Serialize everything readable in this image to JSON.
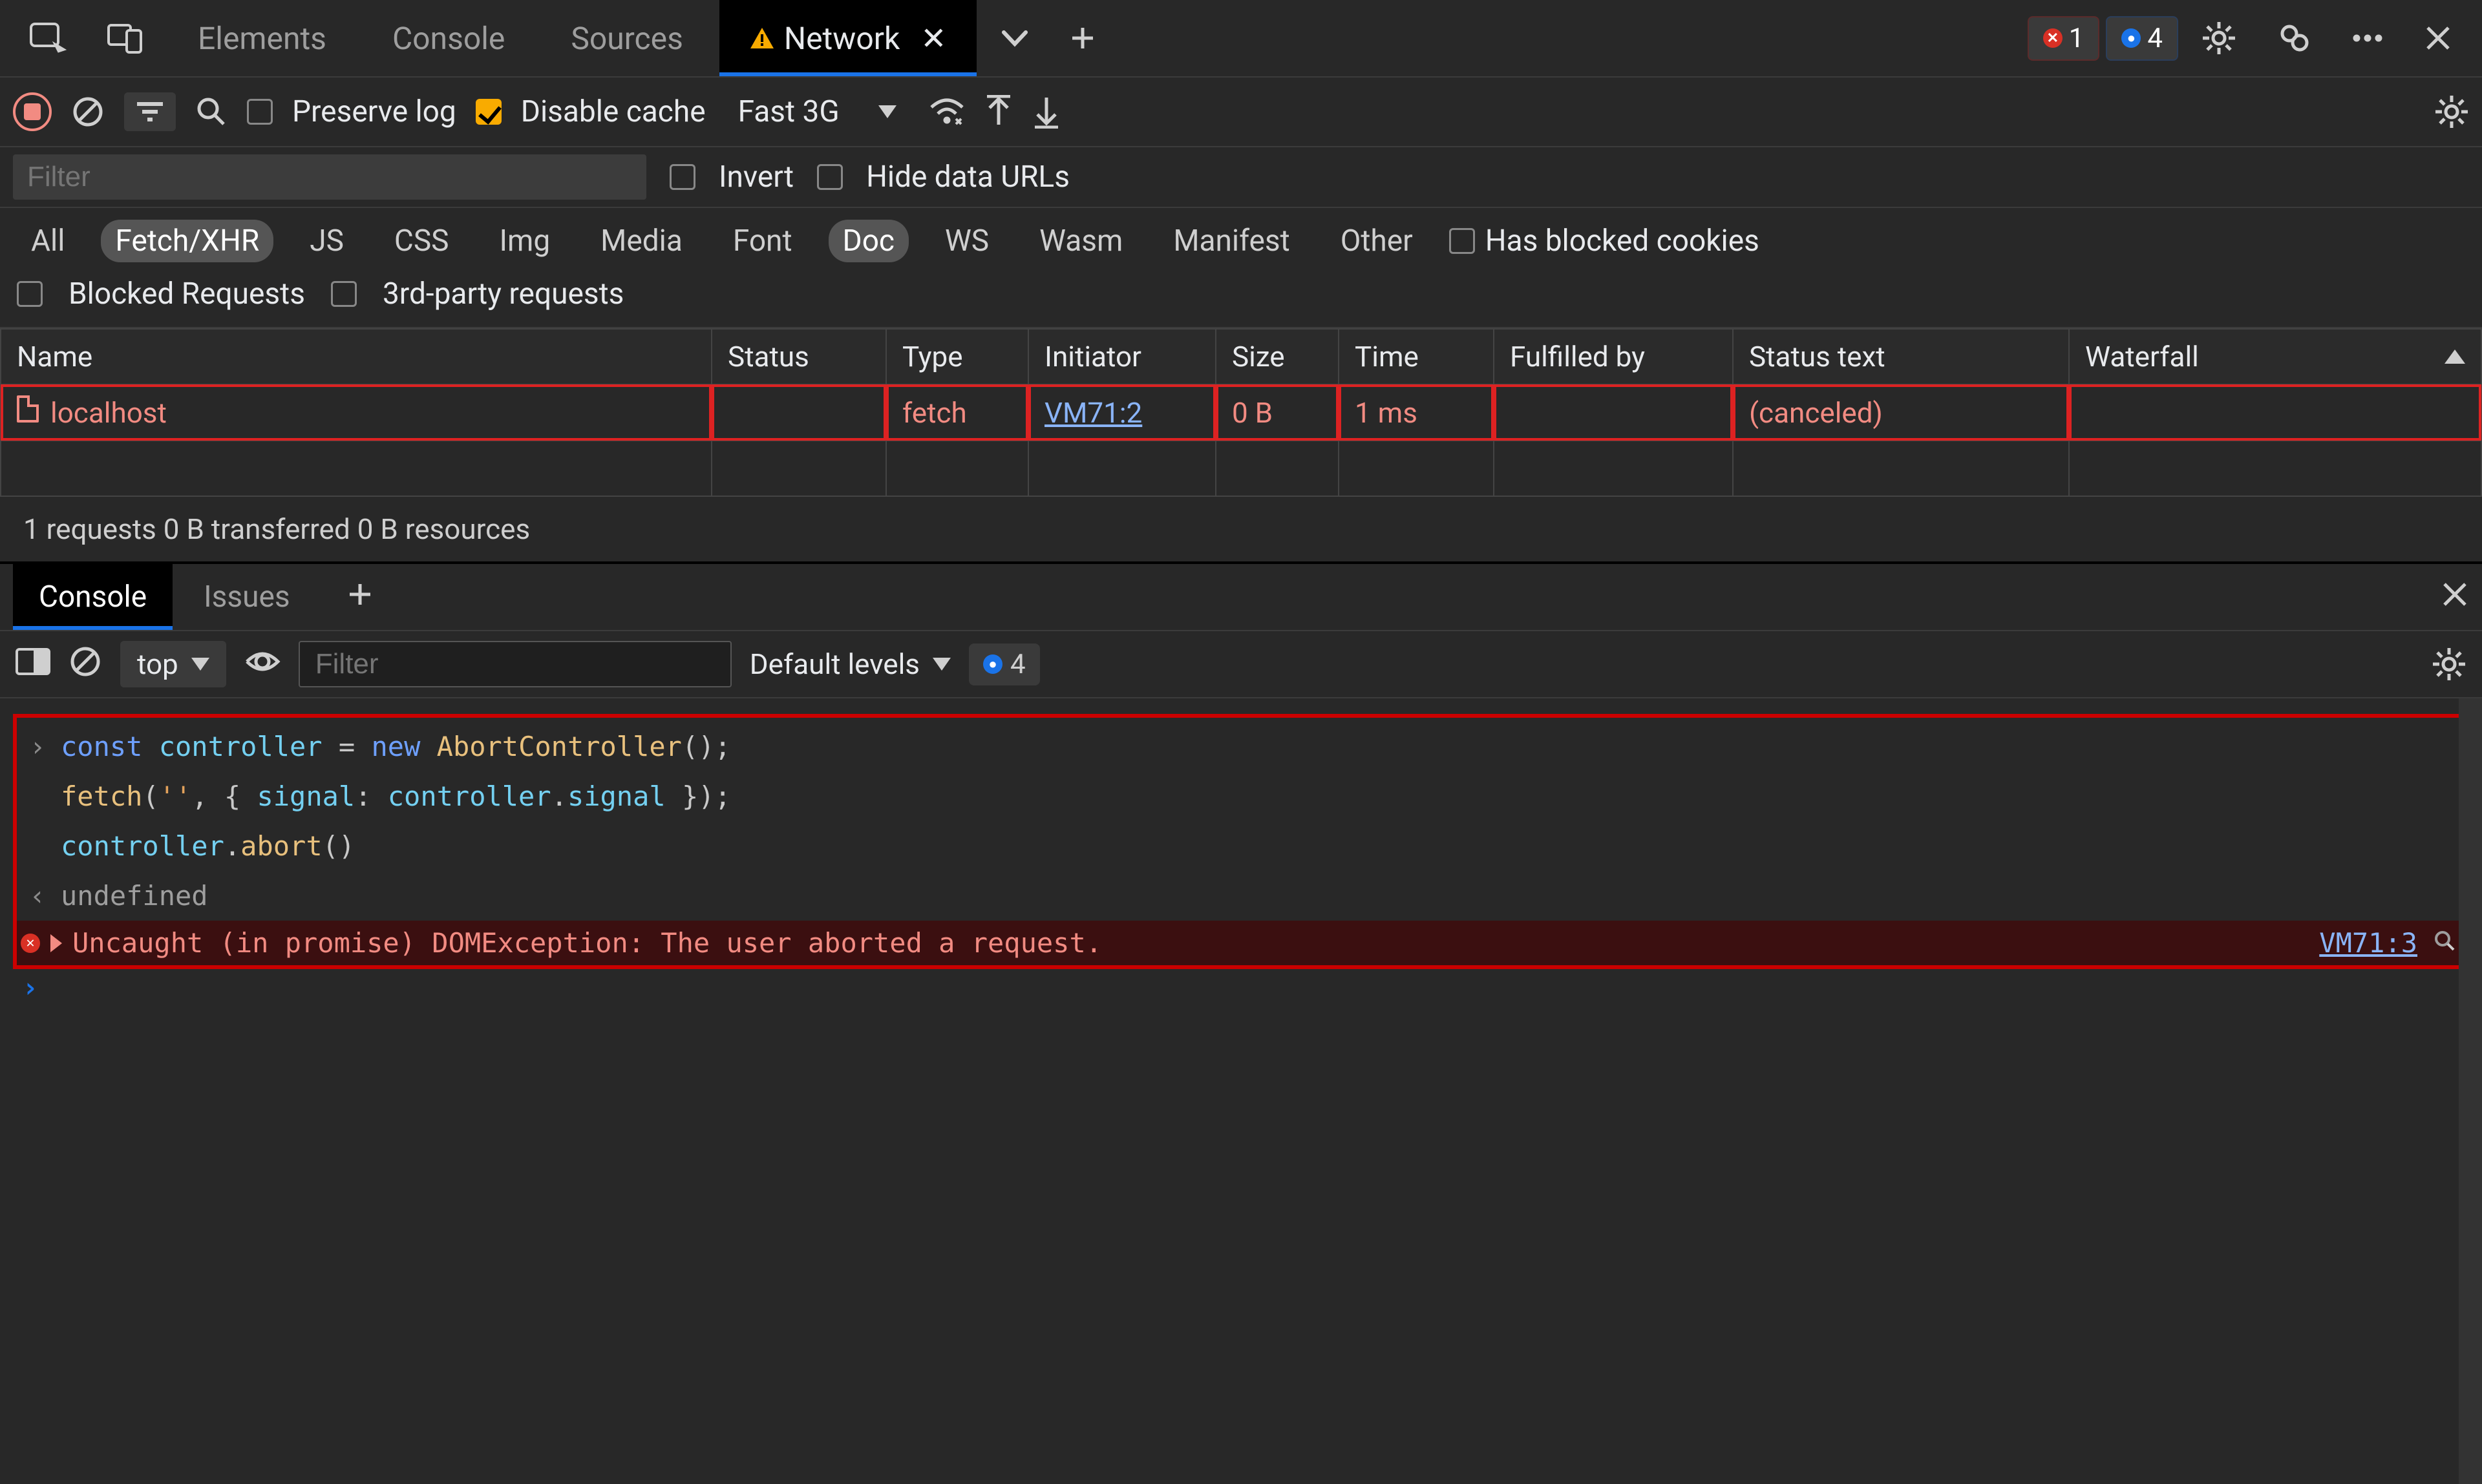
{
  "mainTabs": {
    "elements": "Elements",
    "console": "Console",
    "sources": "Sources",
    "network": "Network"
  },
  "counts": {
    "errors": "1",
    "info": "4"
  },
  "netToolbar": {
    "preserve": "Preserve log",
    "disable": "Disable cache",
    "throttle": "Fast 3G"
  },
  "filterBar": {
    "placeholder": "Filter",
    "invert": "Invert",
    "hide": "Hide data URLs"
  },
  "typeChips": {
    "all": "All",
    "fetch": "Fetch/XHR",
    "js": "JS",
    "css": "CSS",
    "img": "Img",
    "media": "Media",
    "font": "Font",
    "doc": "Doc",
    "ws": "WS",
    "wasm": "Wasm",
    "manifest": "Manifest",
    "other": "Other",
    "hasBlocked": "Has blocked cookies",
    "blockedReq": "Blocked Requests",
    "thirdParty": "3rd-party requests"
  },
  "tableHead": {
    "name": "Name",
    "status": "Status",
    "type": "Type",
    "initiator": "Initiator",
    "size": "Size",
    "time": "Time",
    "fulfilled": "Fulfilled by",
    "statusText": "Status text",
    "waterfall": "Waterfall"
  },
  "row": {
    "name": "localhost",
    "type": "fetch",
    "initiator": "VM71:2",
    "size": "0 B",
    "time": "1 ms",
    "statusText": "(canceled)"
  },
  "summary": "1 requests   0 B transferred   0 B resources",
  "drawer": {
    "console": "Console",
    "issues": "Issues"
  },
  "consoleToolbar": {
    "ctx": "top",
    "filterPlaceholder": "Filter",
    "levels": "Default levels",
    "info": "4"
  },
  "code": {
    "l1a": "const",
    "l1b": "controller",
    "l1c": "=",
    "l1d": "new",
    "l1e": "AbortController",
    "l1f": "();",
    "l2a": "fetch",
    "l2b": "(",
    "l2c": "''",
    "l2d": ", { ",
    "l2e": "signal",
    "l2f": ": ",
    "l2g": "controller",
    "l2h": ".",
    "l2i": "signal",
    "l2j": " });",
    "l3a": "controller",
    "l3b": ".",
    "l3c": "abort",
    "l3d": "()",
    "ret": "undefined",
    "err": "Uncaught (in promise) DOMException: The user aborted a request.",
    "errLink": "VM71:3"
  }
}
